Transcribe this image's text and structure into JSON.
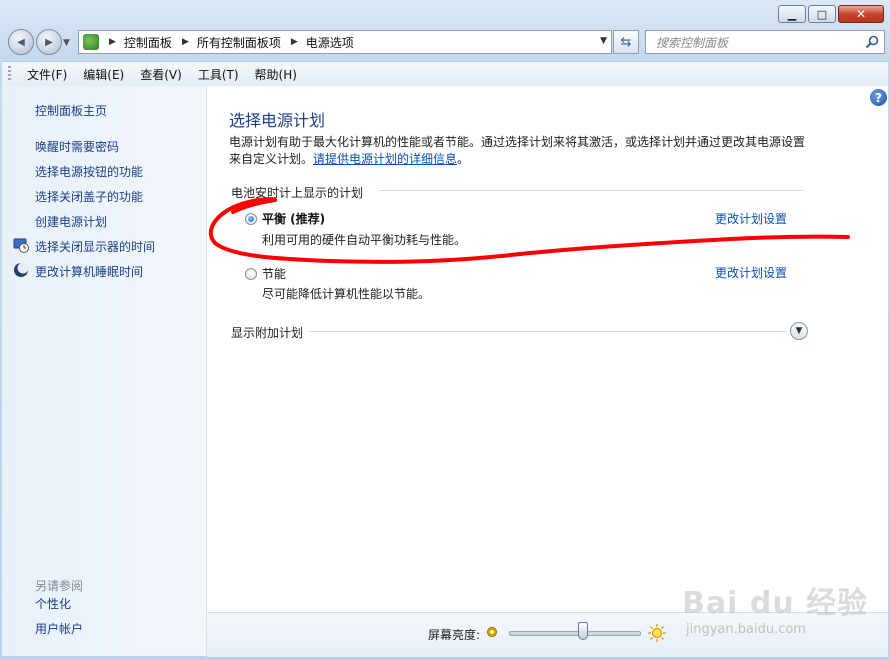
{
  "window": {
    "minimize_glyph": "▁",
    "maximize_glyph": "□",
    "close_glyph": "✕"
  },
  "navbar": {
    "back_glyph": "◀",
    "forward_glyph": "▶",
    "breadcrumbs": [
      "控制面板",
      "所有控制面板项",
      "电源选项"
    ],
    "refresh_glyph": "⇆",
    "search_placeholder": "搜索控制面板"
  },
  "menubar": {
    "items": [
      "文件(F)",
      "编辑(E)",
      "查看(V)",
      "工具(T)",
      "帮助(H)"
    ]
  },
  "sidebar": {
    "home": "控制面板主页",
    "links": [
      "唤醒时需要密码",
      "选择电源按钮的功能",
      "选择关闭盖子的功能",
      "创建电源计划",
      "选择关闭显示器的时间",
      "更改计算机睡眠时间"
    ],
    "see_also_title": "另请参阅",
    "see_also": [
      "个性化",
      "用户帐户"
    ]
  },
  "main": {
    "title": "选择电源计划",
    "description_text": "电源计划有助于最大化计算机的性能或者节能。通过选择计划来将其激活，或选择计划并通过更改其电源设置来自定义计划。",
    "description_link": "请提供电源计划的详细信息",
    "description_end": "。",
    "group_heading": "电池安时计上显示的计划",
    "plans": [
      {
        "name": "平衡 (推荐)",
        "description": "利用可用的硬件自动平衡功耗与性能。",
        "selected": true,
        "link": "更改计划设置"
      },
      {
        "name": "节能",
        "description": "尽可能降低计算机性能以节能。",
        "selected": false,
        "link": "更改计划设置"
      }
    ],
    "additional_plans": "显示附加计划",
    "help_glyph": "?"
  },
  "bottom": {
    "brightness_label": "屏幕亮度:",
    "brightness_level": 0.57
  },
  "annotation": {
    "color": "#ff0000"
  },
  "watermark": {
    "logo": "Bai du 经验",
    "url": "jingyan.baidu.com"
  }
}
